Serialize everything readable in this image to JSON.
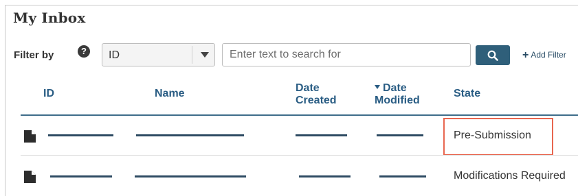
{
  "page": {
    "title": "My Inbox"
  },
  "filter": {
    "label": "Filter by",
    "help_icon": "question-circle-icon",
    "field_value": "ID",
    "search_placeholder": "Enter text to search for",
    "search_icon": "search-icon",
    "add_filter_label": "Add Filter"
  },
  "table": {
    "columns": [
      {
        "label": "ID",
        "sorted": false
      },
      {
        "label": "Name",
        "sorted": false
      },
      {
        "label": "Date Created",
        "sorted": false
      },
      {
        "label": "Date Modified",
        "sorted": true
      },
      {
        "label": "State",
        "sorted": false
      }
    ],
    "rows": [
      {
        "icon": "document-icon",
        "state": "Pre-Submission",
        "highlighted": true
      },
      {
        "icon": "document-icon",
        "state": "Modifications Required",
        "highlighted": false
      }
    ]
  },
  "colors": {
    "header_text": "#2a5d84",
    "search_button": "#2f5f7a",
    "highlight_border": "#e8664f",
    "redaction": "#2d4a62"
  }
}
